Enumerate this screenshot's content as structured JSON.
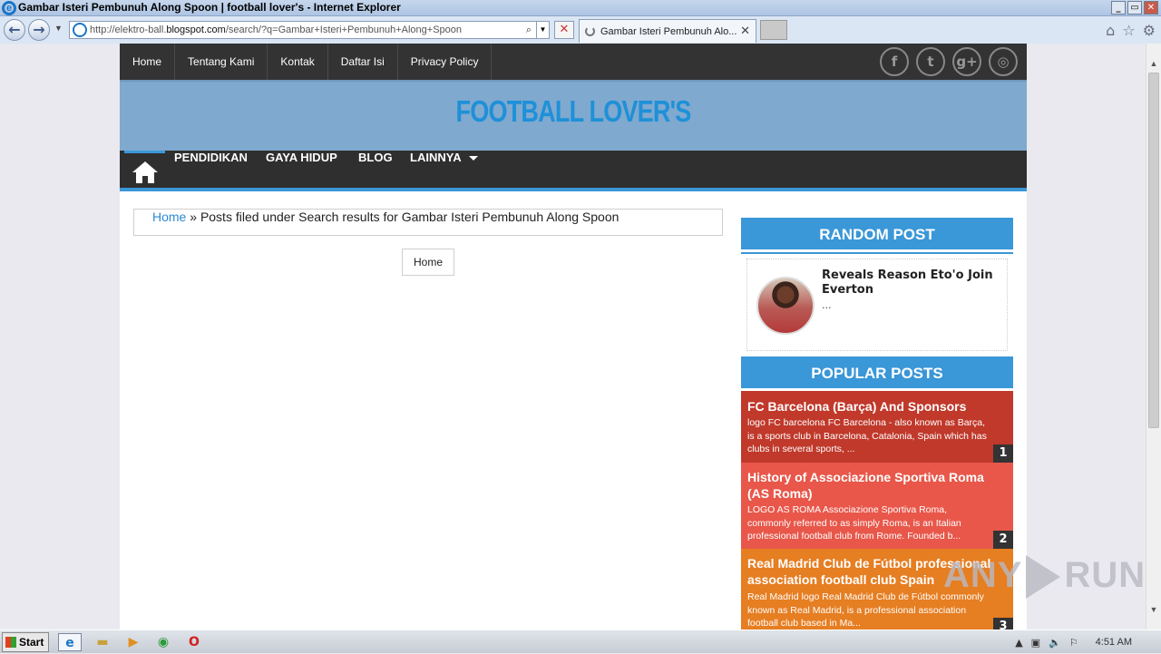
{
  "window": {
    "title": "Gambar Isteri Pembunuh Along Spoon | football lover's - Internet Explorer",
    "controls": [
      "_",
      "▭",
      "✕"
    ]
  },
  "browser": {
    "url_prefix": "http://elektro-ball.",
    "url_domain": "blogspot.com",
    "url_path": "/search/?q=Gambar+Isteri+Pembunuh+Along+Spoon",
    "tab_label": "Gambar Isteri Pembunuh Alo...",
    "icons": [
      "back-icon",
      "forward-icon",
      "search-icon",
      "stop-icon",
      "home-icon",
      "favorites-star-icon",
      "gear-icon"
    ]
  },
  "site": {
    "top_nav": [
      "Home",
      "Tentang Kami",
      "Kontak",
      "Daftar Isi",
      "Privacy Policy"
    ],
    "social": [
      {
        "icon": "facebook-icon",
        "glyph": "f"
      },
      {
        "icon": "twitter-icon",
        "glyph": "t"
      },
      {
        "icon": "google-plus-icon",
        "glyph": "g+"
      },
      {
        "icon": "instagram-icon",
        "glyph": "◎"
      }
    ],
    "name": "FOOTBALL LOVER'S",
    "main_nav": [
      "PENDIDIKAN",
      "GAYA HIDUP",
      "BLOG",
      "LAINNYA"
    ],
    "accent_color": "#3a97d8"
  },
  "breadcrumb": {
    "home": "Home",
    "sep": " » ",
    "text": "Posts filed under Search results for Gambar Isteri Pembunuh Along Spoon"
  },
  "home_button": "Home",
  "random_post": {
    "title": "RANDOM POST",
    "post_title": "Reveals Reason Eto'o Join Everton",
    "excerpt": "..."
  },
  "popular_posts": {
    "title": "POPULAR POSTS",
    "items": [
      {
        "title": "FC Barcelona (Barça) And Sponsors",
        "excerpt": "logo  FC barcelona FC Barcelona - also known as Barça, is a sports club in Barcelona, Catalonia, Spain which has clubs in several sports, ...",
        "rank": "1",
        "color": "#c0392b"
      },
      {
        "title": "History of Associazione Sportiva Roma (AS Roma)",
        "excerpt": "LOGO AS ROMA Associazione Sportiva Roma, commonly referred to as simply Roma, is an Italian professional football club from Rome. Founded b...",
        "rank": "2",
        "color": "#e8574a"
      },
      {
        "title": "Real Madrid Club de Fútbol professional association football club Spain",
        "excerpt": " Real Madrid logo Real Madrid Club de Fútbol commonly known as Real Madrid, is a professional association football club based in Ma...",
        "rank": "3",
        "color": "#e67e22"
      }
    ]
  },
  "watermark": {
    "left": "ANY",
    "right": "RUN"
  },
  "taskbar": {
    "start_label": "Start",
    "apps": [
      "internet-explorer-icon",
      "file-explorer-icon",
      "media-player-icon",
      "chrome-icon",
      "opera-icon"
    ],
    "clock": "4:51 AM"
  }
}
